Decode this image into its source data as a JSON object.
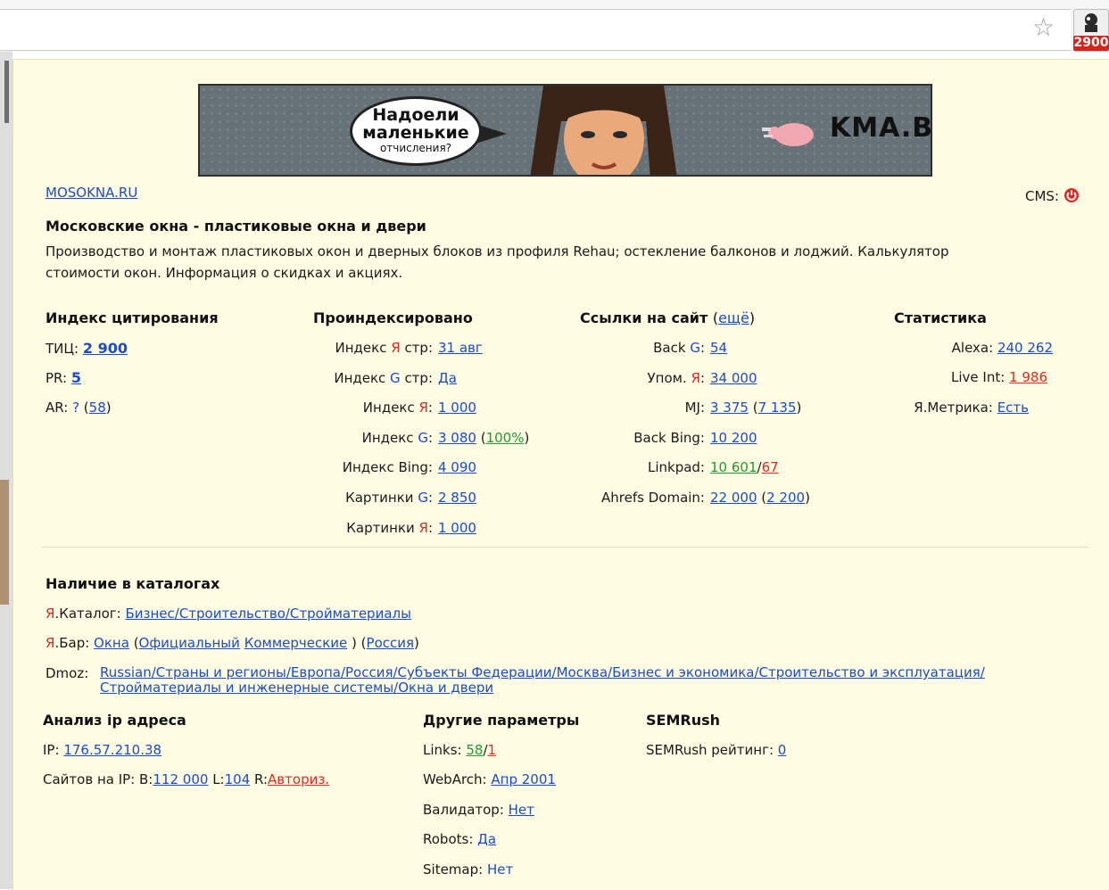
{
  "browser": {
    "extension_badge": "2900"
  },
  "banner": {
    "bubble_line1": "Надоели",
    "bubble_line2": "маленькие",
    "bubble_line3": "отчисления?",
    "brand": "KMA.BIZ"
  },
  "site": {
    "domain": "MOSOKNA.RU",
    "cms_label": "CMS:",
    "title": "Московские окна - пластиковые окна и двери",
    "description_line1": "Производство и монтаж пластиковых окон и дверных блоков из профиля Rehau; остекление балконов и лоджий. Калькулятор",
    "description_line2": "стоимости окон. Информация о скидках и акциях."
  },
  "citation": {
    "header": "Индекс цитирования",
    "tic_label": "ТИЦ:",
    "tic_value": "2 900",
    "pr_label": "PR:",
    "pr_value": "5",
    "ar_label": "AR:",
    "ar_value": "?",
    "ar_extra": "58"
  },
  "indexed": {
    "header": "Проиндексировано",
    "rows": [
      {
        "prefix": "Индекс ",
        "engine": "Я",
        "suffix": " стр:",
        "value": "31 авг"
      },
      {
        "prefix": "Индекс ",
        "engine": "G",
        "suffix": " стр:",
        "value": "Да"
      },
      {
        "prefix": "Индекс ",
        "engine": "Я",
        "suffix": ":",
        "value": "1 000"
      },
      {
        "prefix": "Индекс ",
        "engine": "G",
        "suffix": ":",
        "value": "3 080",
        "extra": "100%"
      },
      {
        "prefix": "Индекс Bing:",
        "engine": "",
        "suffix": "",
        "value": "4 090"
      },
      {
        "prefix": "Картинки ",
        "engine": "G",
        "suffix": ":",
        "value": "2 850"
      },
      {
        "prefix": "Картинки ",
        "engine": "Я",
        "suffix": ":",
        "value": "1 000"
      }
    ]
  },
  "links": {
    "header": "Ссылки на сайт",
    "more": "ещё",
    "rows": [
      {
        "prefix": "Back ",
        "engine": "G",
        "suffix": ":",
        "value": "54"
      },
      {
        "prefix": "Упом. ",
        "engine": "Я",
        "suffix": ":",
        "value": "34 000"
      },
      {
        "prefix": "MJ:",
        "engine": "",
        "suffix": "",
        "value": "3 375",
        "extra": "7 135"
      },
      {
        "prefix": "Back Bing:",
        "engine": "",
        "suffix": "",
        "value": "10 200"
      },
      {
        "prefix": "Linkpad:",
        "engine": "",
        "suffix": "",
        "value": "10 601",
        "value2": "67"
      },
      {
        "prefix": "Ahrefs Domain:",
        "engine": "",
        "suffix": "",
        "value": "22 000",
        "extra": "2 200"
      }
    ]
  },
  "stats": {
    "header": "Статистика",
    "alexa_label": "Alexa:",
    "alexa_value": "240 262",
    "liveint_label": "Live Int:",
    "liveint_value": "1 986",
    "metrika_label": "Я.Метрика:",
    "metrika_value": "Есть"
  },
  "catalogs": {
    "header": "Наличие в каталогах",
    "yacat_label_y": "Я",
    "yacat_label_rest": ".Каталог:",
    "yacat_value": "Бизнес/Строительство/Стройматериалы",
    "yabar_label_y": "Я",
    "yabar_label_rest": ".Бар:",
    "yabar_value": "Окна",
    "yabar_official": "Официальный",
    "yabar_commercial": "Коммерческие",
    "yabar_region": "Россия",
    "dmoz_label": "Dmoz:",
    "dmoz_line1": "Russian/Страны и регионы/Европа/Россия/Субъекты Федерации/Москва/Бизнес и экономика/Строительство и эксплуатация/",
    "dmoz_line2": "Стройматериалы и инженерные системы/Окна и двери"
  },
  "ip": {
    "header": "Анализ ip адреса",
    "ip_label": "IP:",
    "ip_value": "176.57.210.38",
    "sites_label": "Сайтов на IP:",
    "b_label": "B:",
    "b_value": "112 000",
    "l_label": "L:",
    "l_value": "104",
    "r_label": "R:",
    "r_value": "Авториз."
  },
  "other": {
    "header": "Другие параметры",
    "links_label": "Links:",
    "links_value": "58",
    "links_value2": "1",
    "webarch_label": "WebArch:",
    "webarch_value": "Апр 2001",
    "validator_label": "Валидатор:",
    "validator_value": "Нет",
    "robots_label": "Robots:",
    "robots_value": "Да",
    "sitemap_label": "Sitemap:",
    "sitemap_value": "Нет"
  },
  "semrush": {
    "header": "SEMRush",
    "rating_label": "SEMRush рейтинг:",
    "rating_value": "0"
  }
}
